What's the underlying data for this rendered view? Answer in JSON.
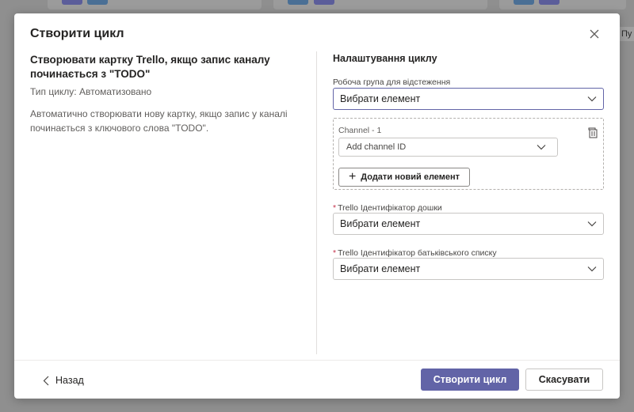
{
  "background": {
    "side_text": "Пу"
  },
  "dialog": {
    "title": "Створити цикл",
    "close_icon": "close-icon"
  },
  "flow": {
    "title": "Створювати картку Trello, якщо запис каналу починається з \"TODO\"",
    "type": "Тип циклу: Автоматизовано",
    "description": "Автоматично створювати нову картку, якщо запис у каналі починається з ключового слова \"TODO\"."
  },
  "settings": {
    "title": "Налаштування циклу",
    "team_label": "Робоча група для відстеження",
    "team_value": "Вибрати елемент",
    "channel_label": "Channel - 1",
    "channel_value": "Add channel ID",
    "add_item_label": "Додати новий елемент",
    "board_label": "Trello Ідентифікатор дошки",
    "board_value": "Вибрати елемент",
    "list_label": "Trello Ідентифікатор батьківського списку",
    "list_value": "Вибрати елемент",
    "required_mark": "*"
  },
  "footer": {
    "back_label": "Назад",
    "create_label": "Створити цикл",
    "cancel_label": "Скасувати"
  },
  "colors": {
    "accent": "#6264a7",
    "required": "#c4314b",
    "overlay": "#8f8f8f"
  }
}
